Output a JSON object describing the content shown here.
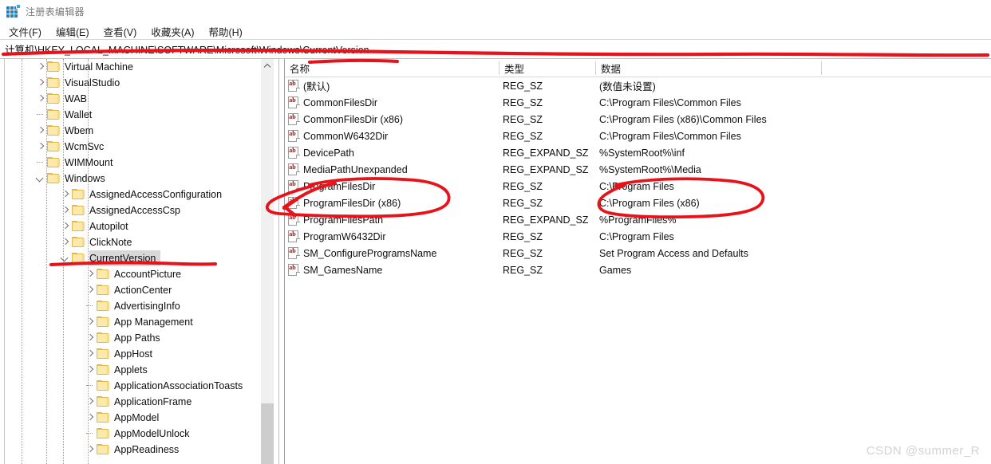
{
  "window": {
    "title": "注册表编辑器",
    "icon": "registry-editor-icon"
  },
  "menubar": {
    "items": [
      {
        "label": "文件(F)",
        "name": "menu-file"
      },
      {
        "label": "编辑(E)",
        "name": "menu-edit"
      },
      {
        "label": "查看(V)",
        "name": "menu-view"
      },
      {
        "label": "收藏夹(A)",
        "name": "menu-favorites"
      },
      {
        "label": "帮助(H)",
        "name": "menu-help"
      }
    ]
  },
  "address": {
    "path": "计算机\\HKEY_LOCAL_MACHINE\\SOFTWARE\\Microsoft\\Windows\\CurrentVersion"
  },
  "tree": {
    "nodes": [
      {
        "label": "Virtual Machine",
        "indent": 1,
        "state": "closed",
        "selected": false
      },
      {
        "label": "VisualStudio",
        "indent": 1,
        "state": "closed",
        "selected": false
      },
      {
        "label": "WAB",
        "indent": 1,
        "state": "closed",
        "selected": false
      },
      {
        "label": "Wallet",
        "indent": 1,
        "state": "leaf",
        "selected": false
      },
      {
        "label": "Wbem",
        "indent": 1,
        "state": "closed",
        "selected": false
      },
      {
        "label": "WcmSvc",
        "indent": 1,
        "state": "closed",
        "selected": false
      },
      {
        "label": "WIMMount",
        "indent": 1,
        "state": "leaf",
        "selected": false
      },
      {
        "label": "Windows",
        "indent": 1,
        "state": "open",
        "selected": false
      },
      {
        "label": "AssignedAccessConfiguration",
        "indent": 2,
        "state": "closed",
        "selected": false
      },
      {
        "label": "AssignedAccessCsp",
        "indent": 2,
        "state": "closed",
        "selected": false
      },
      {
        "label": "Autopilot",
        "indent": 2,
        "state": "closed",
        "selected": false
      },
      {
        "label": "ClickNote",
        "indent": 2,
        "state": "closed",
        "selected": false
      },
      {
        "label": "CurrentVersion",
        "indent": 2,
        "state": "open",
        "selected": true
      },
      {
        "label": "AccountPicture",
        "indent": 3,
        "state": "closed",
        "selected": false
      },
      {
        "label": "ActionCenter",
        "indent": 3,
        "state": "closed",
        "selected": false
      },
      {
        "label": "AdvertisingInfo",
        "indent": 3,
        "state": "leaf",
        "selected": false
      },
      {
        "label": "App Management",
        "indent": 3,
        "state": "closed",
        "selected": false
      },
      {
        "label": "App Paths",
        "indent": 3,
        "state": "closed",
        "selected": false
      },
      {
        "label": "AppHost",
        "indent": 3,
        "state": "closed",
        "selected": false
      },
      {
        "label": "Applets",
        "indent": 3,
        "state": "closed",
        "selected": false
      },
      {
        "label": "ApplicationAssociationToasts",
        "indent": 3,
        "state": "leaf",
        "selected": false
      },
      {
        "label": "ApplicationFrame",
        "indent": 3,
        "state": "closed",
        "selected": false
      },
      {
        "label": "AppModel",
        "indent": 3,
        "state": "closed",
        "selected": false
      },
      {
        "label": "AppModelUnlock",
        "indent": 3,
        "state": "leaf",
        "selected": false
      },
      {
        "label": "AppReadiness",
        "indent": 3,
        "state": "closed",
        "selected": false
      }
    ]
  },
  "list": {
    "columns": [
      {
        "label": "名称",
        "name": "column-name"
      },
      {
        "label": "类型",
        "name": "column-type"
      },
      {
        "label": "数据",
        "name": "column-data"
      }
    ],
    "rows": [
      {
        "name": "(默认)",
        "type": "REG_SZ",
        "data": "(数值未设置)"
      },
      {
        "name": "CommonFilesDir",
        "type": "REG_SZ",
        "data": "C:\\Program Files\\Common Files"
      },
      {
        "name": "CommonFilesDir (x86)",
        "type": "REG_SZ",
        "data": "C:\\Program Files (x86)\\Common Files"
      },
      {
        "name": "CommonW6432Dir",
        "type": "REG_SZ",
        "data": "C:\\Program Files\\Common Files"
      },
      {
        "name": "DevicePath",
        "type": "REG_EXPAND_SZ",
        "data": "%SystemRoot%\\inf"
      },
      {
        "name": "MediaPathUnexpanded",
        "type": "REG_EXPAND_SZ",
        "data": "%SystemRoot%\\Media"
      },
      {
        "name": "ProgramFilesDir",
        "type": "REG_SZ",
        "data": "C:\\Program Files"
      },
      {
        "name": "ProgramFilesDir (x86)",
        "type": "REG_SZ",
        "data": "C:\\Program Files (x86)"
      },
      {
        "name": "ProgramFilesPath",
        "type": "REG_EXPAND_SZ",
        "data": "%ProgramFiles%"
      },
      {
        "name": "ProgramW6432Dir",
        "type": "REG_SZ",
        "data": "C:\\Program Files"
      },
      {
        "name": "SM_ConfigureProgramsName",
        "type": "REG_SZ",
        "data": "Set Program Access and Defaults"
      },
      {
        "name": "SM_GamesName",
        "type": "REG_SZ",
        "data": "Games"
      }
    ],
    "value_icon": "ab-string-value-icon"
  },
  "annotations": {
    "color": "#e8131a",
    "marks": [
      "underline-address-path",
      "underline-currentversion-node",
      "underline-name-column-header",
      "arrow-to-programfilesdir-rows",
      "ellipse-around-programfilesdir-names",
      "ellipse-around-programfilesdir-values"
    ]
  },
  "watermark": {
    "text": "CSDN @summer_R"
  }
}
